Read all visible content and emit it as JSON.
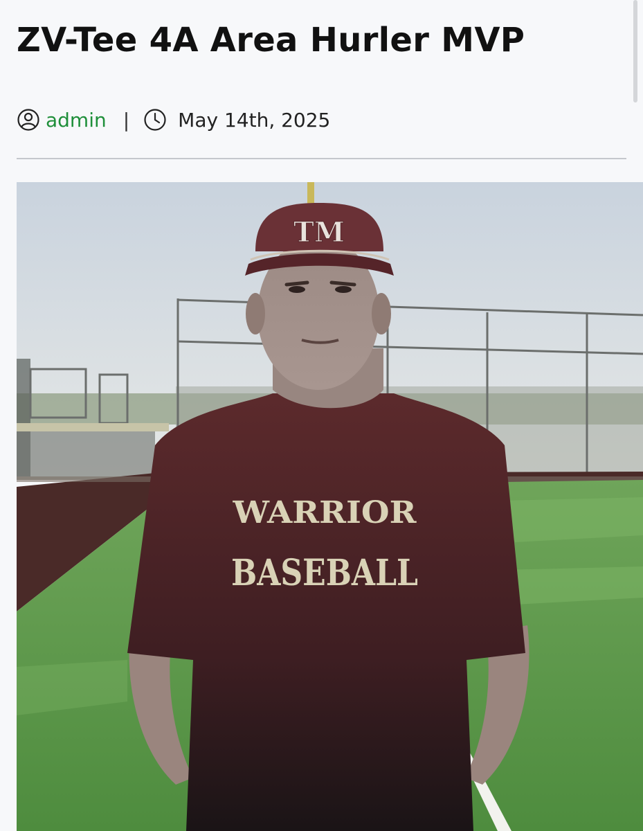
{
  "post": {
    "title": "ZV-Tee 4A Area Hurler MVP",
    "author": "admin",
    "separator": "|",
    "date": "May 14th, 2025"
  },
  "icons": {
    "author": "user-circle-icon",
    "date": "clock-icon"
  },
  "colors": {
    "author_link": "#1f8f3a",
    "divider": "#c5c8cc"
  },
  "image": {
    "shirt_text_line1": "WARRIOR",
    "shirt_text_line2": "BASEBALL",
    "cap_logo": "TM"
  }
}
